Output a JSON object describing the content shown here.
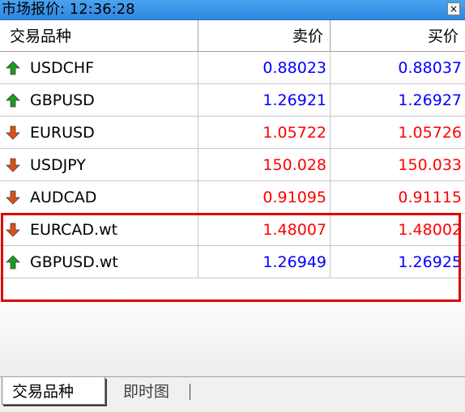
{
  "window": {
    "title": "市场报价: 12:36:28",
    "close_glyph": "×"
  },
  "columns": {
    "symbol": "交易品种",
    "bid": "卖价",
    "ask": "买价"
  },
  "colors": {
    "up": "#0000ff",
    "down": "#ff0000",
    "up_arrow": "#18a018",
    "down_arrow": "#e05010",
    "highlight": "#e00000"
  },
  "rows": [
    {
      "symbol": "USDCHF",
      "bid": "0.88023",
      "ask": "0.88037",
      "direction": "up"
    },
    {
      "symbol": "GBPUSD",
      "bid": "1.26921",
      "ask": "1.26927",
      "direction": "up"
    },
    {
      "symbol": "EURUSD",
      "bid": "1.05722",
      "ask": "1.05726",
      "direction": "down"
    },
    {
      "symbol": "USDJPY",
      "bid": "150.028",
      "ask": "150.033",
      "direction": "down"
    },
    {
      "symbol": "AUDCAD",
      "bid": "0.91095",
      "ask": "0.91115",
      "direction": "down"
    },
    {
      "symbol": "EURCAD.wt",
      "bid": "1.48007",
      "ask": "1.48002",
      "direction": "down"
    },
    {
      "symbol": "GBPUSD.wt",
      "bid": "1.26949",
      "ask": "1.26925",
      "direction": "up"
    }
  ],
  "tabs": [
    {
      "label": "交易品种",
      "active": true
    },
    {
      "label": "即时图",
      "active": false
    }
  ]
}
